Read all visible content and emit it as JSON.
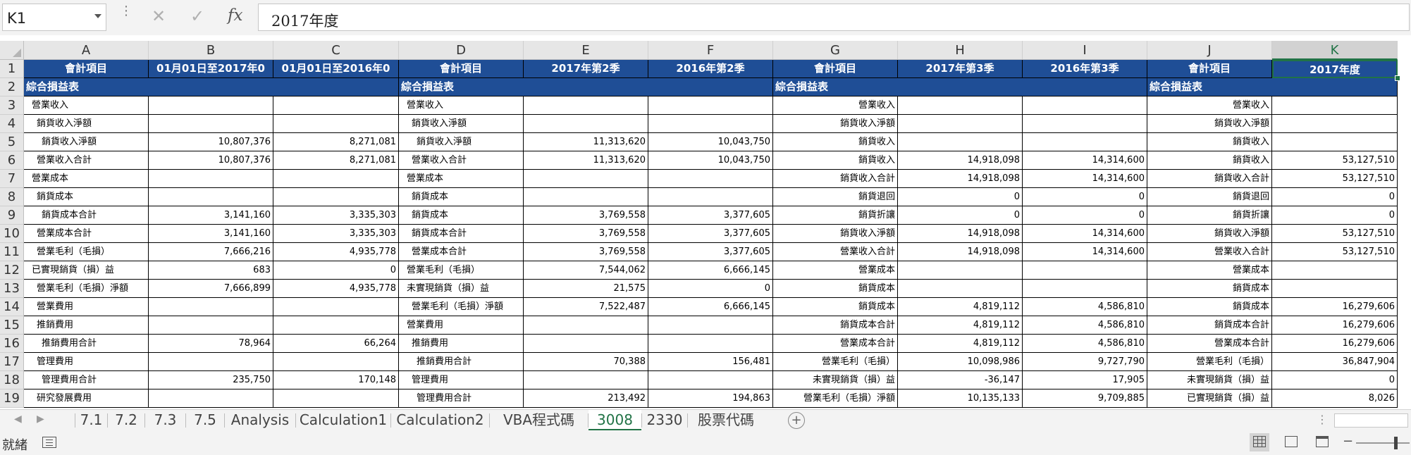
{
  "name_box": "K1",
  "formula_value": "2017年度",
  "column_headers": [
    "A",
    "B",
    "C",
    "D",
    "E",
    "F",
    "G",
    "H",
    "I",
    "J",
    "K"
  ],
  "selected_column": "K",
  "row_numbers": [
    "1",
    "2",
    "3",
    "4",
    "5",
    "6",
    "7",
    "8",
    "9",
    "10",
    "11",
    "12",
    "13",
    "14",
    "15",
    "16",
    "17",
    "18",
    "19"
  ],
  "row1_headers": [
    "會計項目",
    "01月01日至2017年0",
    "01月01日至2016年0",
    "會計項目",
    "2017年第2季",
    "2016年第2季",
    "會計項目",
    "2017年第3季",
    "2016年第3季",
    "會計項目",
    "2017年度"
  ],
  "section_title": "綜合損益表",
  "rows": [
    [
      "營業收入",
      "",
      "",
      "營業收入",
      "",
      "",
      "營業收入",
      "",
      "",
      "營業收入",
      ""
    ],
    [
      "銷貨收入淨額",
      "",
      "",
      "銷貨收入淨額",
      "",
      "",
      "銷貨收入淨額",
      "",
      "",
      "銷貨收入淨額",
      ""
    ],
    [
      "銷貨收入淨額",
      "10,807,376",
      "8,271,081",
      "銷貨收入淨額",
      "11,313,620",
      "10,043,750",
      "銷貨收入",
      "",
      "",
      "銷貨收入",
      ""
    ],
    [
      "營業收入合計",
      "10,807,376",
      "8,271,081",
      "營業收入合計",
      "11,313,620",
      "10,043,750",
      "銷貨收入",
      "14,918,098",
      "14,314,600",
      "銷貨收入",
      "53,127,510"
    ],
    [
      "營業成本",
      "",
      "",
      "營業成本",
      "",
      "",
      "銷貨收入合計",
      "14,918,098",
      "14,314,600",
      "銷貨收入合計",
      "53,127,510"
    ],
    [
      "銷貨成本",
      "",
      "",
      "銷貨成本",
      "",
      "",
      "銷貨退回",
      "0",
      "0",
      "銷貨退回",
      "0"
    ],
    [
      "銷貨成本合計",
      "3,141,160",
      "3,335,303",
      "銷貨成本",
      "3,769,558",
      "3,377,605",
      "銷貨折讓",
      "0",
      "0",
      "銷貨折讓",
      "0"
    ],
    [
      "營業成本合計",
      "3,141,160",
      "3,335,303",
      "銷貨成本合計",
      "3,769,558",
      "3,377,605",
      "銷貨收入淨額",
      "14,918,098",
      "14,314,600",
      "銷貨收入淨額",
      "53,127,510"
    ],
    [
      "營業毛利（毛損）",
      "7,666,216",
      "4,935,778",
      "營業成本合計",
      "3,769,558",
      "3,377,605",
      "營業收入合計",
      "14,918,098",
      "14,314,600",
      "營業收入合計",
      "53,127,510"
    ],
    [
      "已實現銷貨（損）益",
      "683",
      "0",
      "營業毛利（毛損）",
      "7,544,062",
      "6,666,145",
      "營業成本",
      "",
      "",
      "營業成本",
      ""
    ],
    [
      "營業毛利（毛損）淨額",
      "7,666,899",
      "4,935,778",
      "未實現銷貨（損）益",
      "21,575",
      "0",
      "銷貨成本",
      "",
      "",
      "銷貨成本",
      ""
    ],
    [
      "營業費用",
      "",
      "",
      "營業毛利（毛損）淨額",
      "7,522,487",
      "6,666,145",
      "銷貨成本",
      "4,819,112",
      "4,586,810",
      "銷貨成本",
      "16,279,606"
    ],
    [
      "推銷費用",
      "",
      "",
      "營業費用",
      "",
      "",
      "銷貨成本合計",
      "4,819,112",
      "4,586,810",
      "銷貨成本合計",
      "16,279,606"
    ],
    [
      "推銷費用合計",
      "78,964",
      "66,264",
      "推銷費用",
      "",
      "",
      "營業成本合計",
      "4,819,112",
      "4,586,810",
      "營業成本合計",
      "16,279,606"
    ],
    [
      "管理費用",
      "",
      "",
      "推銷費用合計",
      "70,388",
      "156,481",
      "營業毛利（毛損）",
      "10,098,986",
      "9,727,790",
      "營業毛利（毛損）",
      "36,847,904"
    ],
    [
      "管理費用合計",
      "235,750",
      "170,148",
      "管理費用",
      "",
      "",
      "未實現銷貨（損）益",
      "-36,147",
      "17,905",
      "未實現銷貨（損）益",
      "0"
    ],
    [
      "研究發展費用",
      "",
      "",
      "管理費用合計",
      "213,492",
      "194,863",
      "營業毛利（毛損）淨額",
      "10,135,133",
      "9,709,885",
      "已實現銷貨（損）益",
      "8,026"
    ]
  ],
  "indent_levels": [
    [
      1,
      0,
      0,
      1,
      0,
      0,
      0,
      0,
      0,
      0,
      0
    ],
    [
      2,
      0,
      0,
      2,
      0,
      0,
      0,
      0,
      0,
      0,
      0
    ],
    [
      3,
      0,
      0,
      3,
      0,
      0,
      0,
      0,
      0,
      0,
      0
    ],
    [
      2,
      0,
      0,
      2,
      0,
      0,
      0,
      0,
      0,
      0,
      0
    ],
    [
      1,
      0,
      0,
      1,
      0,
      0,
      0,
      0,
      0,
      0,
      0
    ],
    [
      2,
      0,
      0,
      2,
      0,
      0,
      0,
      0,
      0,
      0,
      0
    ],
    [
      3,
      0,
      0,
      2,
      0,
      0,
      0,
      0,
      0,
      0,
      0
    ],
    [
      2,
      0,
      0,
      2,
      0,
      0,
      0,
      0,
      0,
      0,
      0
    ],
    [
      2,
      0,
      0,
      2,
      0,
      0,
      0,
      0,
      0,
      0,
      0
    ],
    [
      1,
      0,
      0,
      1,
      0,
      0,
      0,
      0,
      0,
      0,
      0
    ],
    [
      2,
      0,
      0,
      1,
      0,
      0,
      0,
      0,
      0,
      0,
      0
    ],
    [
      2,
      0,
      0,
      2,
      0,
      0,
      0,
      0,
      0,
      0,
      0
    ],
    [
      2,
      0,
      0,
      1,
      0,
      0,
      0,
      0,
      0,
      0,
      0
    ],
    [
      3,
      0,
      0,
      2,
      0,
      0,
      0,
      0,
      0,
      0,
      0
    ],
    [
      2,
      0,
      0,
      3,
      0,
      0,
      0,
      0,
      0,
      0,
      0
    ],
    [
      3,
      0,
      0,
      2,
      0,
      0,
      0,
      0,
      0,
      0,
      0
    ],
    [
      2,
      0,
      0,
      3,
      0,
      0,
      0,
      0,
      0,
      0,
      0
    ]
  ],
  "right_aligned_label_columns": [
    6,
    9
  ],
  "sheet_tabs": [
    "7.1",
    "7.2",
    "7.3",
    "7.5",
    "Analysis",
    "Calculation1",
    "Calculation2",
    "VBA程式碼",
    "3008",
    "2330",
    "股票代碼"
  ],
  "active_tab": "3008",
  "status_text": "就緒",
  "colors": {
    "header_fill": "#1f4e96",
    "accent_green": "#217346",
    "row_band": "#ffffff"
  },
  "icons": {
    "cancel": "close-icon",
    "enter": "check-icon",
    "function": "fx-icon",
    "new_sheet": "plus-circle-icon",
    "macro": "macro-record-icon",
    "normal_view": "grid-view-icon",
    "page_layout": "page-layout-icon",
    "page_break": "page-break-icon"
  }
}
